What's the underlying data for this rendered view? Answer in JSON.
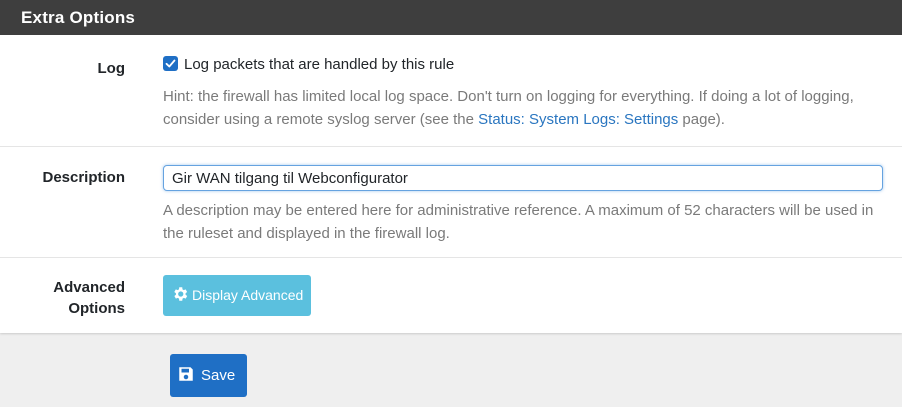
{
  "panel": {
    "title": "Extra Options"
  },
  "log": {
    "label": "Log",
    "checkbox_checked": true,
    "checkbox_label": "Log packets that are handled by this rule",
    "hint_prefix": "Hint: the firewall has limited local log space. Don't turn on logging for everything. If doing a lot of logging, consider using a remote syslog server (see the ",
    "hint_link": "Status: System Logs: Settings",
    "hint_suffix": " page)."
  },
  "description": {
    "label": "Description",
    "value": "Gir WAN tilgang til Webconfigurator",
    "hint": "A description may be entered here for administrative reference. A maximum of 52 characters will be used in the ruleset and displayed in the firewall log."
  },
  "advanced": {
    "label": "Advanced Options",
    "button_label": "Display Advanced",
    "button_icon": "gear-icon"
  },
  "save": {
    "label": "Save",
    "icon": "save-icon"
  },
  "colors": {
    "heading_bg": "#3e3e3e",
    "primary": "#1f6fc5",
    "info": "#5bc0de",
    "link": "#2a76c0",
    "hint_text": "#7a7a7a",
    "page_bg": "#efefef"
  }
}
